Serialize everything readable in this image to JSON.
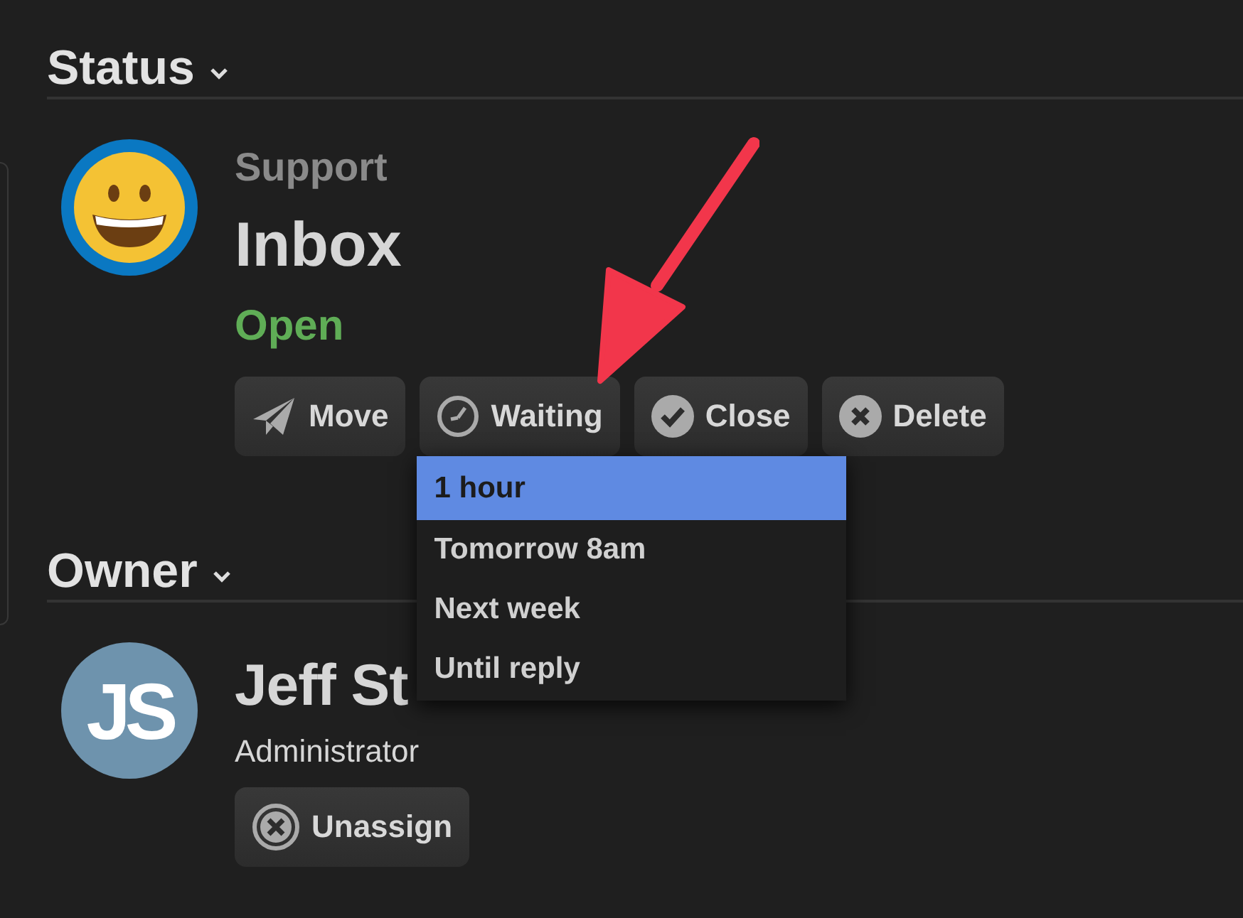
{
  "status": {
    "heading": "Status",
    "category": "Support",
    "name": "Inbox",
    "state": "Open",
    "actions": [
      {
        "kind": "move",
        "label": "Move"
      },
      {
        "kind": "waiting",
        "label": "Waiting"
      },
      {
        "kind": "close",
        "label": "Close"
      },
      {
        "kind": "delete",
        "label": "Delete"
      }
    ]
  },
  "waiting_menu": {
    "items": [
      {
        "label": "1 hour",
        "selected": true
      },
      {
        "label": "Tomorrow 8am",
        "selected": false
      },
      {
        "label": "Next week",
        "selected": false
      },
      {
        "label": "Until reply",
        "selected": false
      }
    ]
  },
  "owner": {
    "heading": "Owner",
    "initials": "JS",
    "name": "Jeff St",
    "role": "Administrator",
    "actions": [
      {
        "kind": "delete",
        "label": "Unassign"
      }
    ]
  }
}
